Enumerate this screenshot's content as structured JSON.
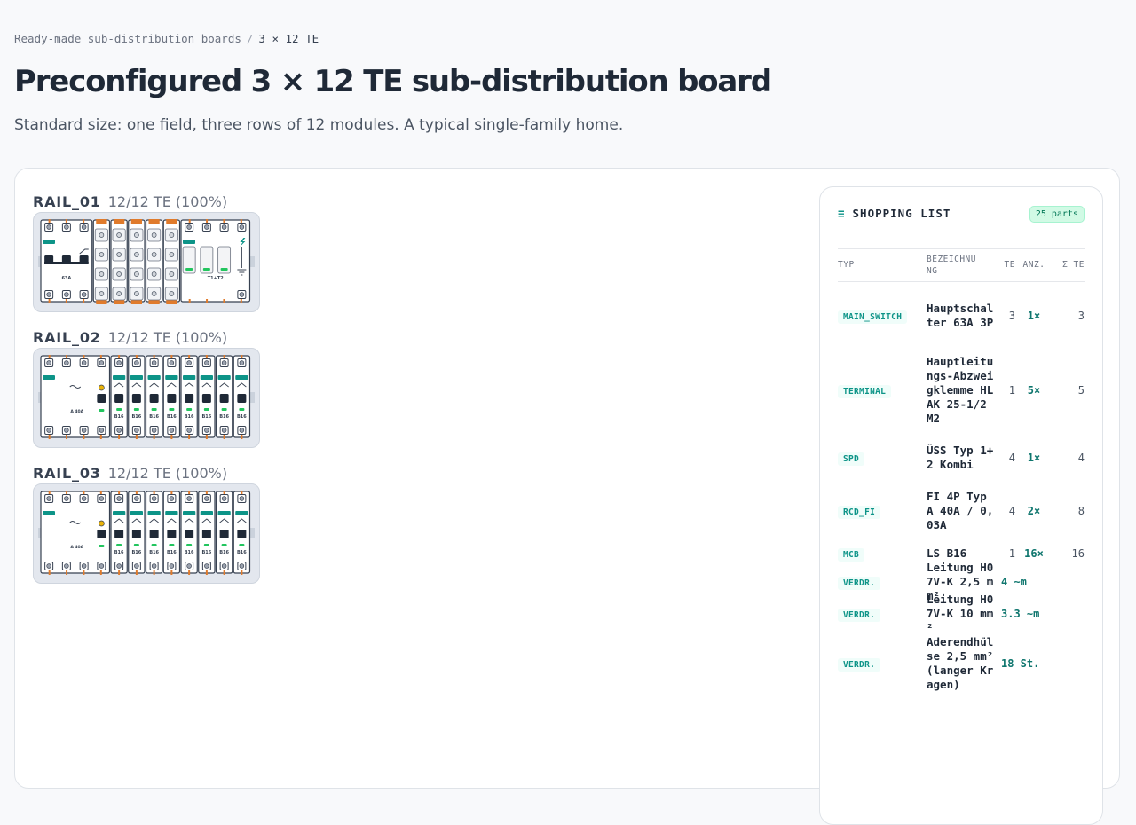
{
  "breadcrumb": {
    "parent": "Ready-made sub-distribution boards",
    "separator": "/",
    "current": "3 × 12 TE"
  },
  "page": {
    "title": "Preconfigured 3 × 12 TE sub-distribution board",
    "subtitle": "Standard size: one field, three rows of 12 modules. A typical single-family home."
  },
  "rails": [
    {
      "name": "RAIL_01",
      "usage": "12/12 TE (100%)",
      "modules": [
        {
          "kind": "main_switch",
          "width": 3,
          "label": "63A"
        },
        {
          "kind": "terminal",
          "width": 1
        },
        {
          "kind": "terminal",
          "width": 1
        },
        {
          "kind": "terminal",
          "width": 1
        },
        {
          "kind": "terminal",
          "width": 1
        },
        {
          "kind": "terminal",
          "width": 1
        },
        {
          "kind": "spd",
          "width": 4,
          "label": "T1+T2"
        }
      ]
    },
    {
      "name": "RAIL_02",
      "usage": "12/12 TE (100%)",
      "modules": [
        {
          "kind": "rcd",
          "width": 4,
          "label": "A 40A"
        },
        {
          "kind": "mcb",
          "width": 1,
          "label": "B16"
        },
        {
          "kind": "mcb",
          "width": 1,
          "label": "B16"
        },
        {
          "kind": "mcb",
          "width": 1,
          "label": "B16"
        },
        {
          "kind": "mcb",
          "width": 1,
          "label": "B16"
        },
        {
          "kind": "mcb",
          "width": 1,
          "label": "B16"
        },
        {
          "kind": "mcb",
          "width": 1,
          "label": "B16"
        },
        {
          "kind": "mcb",
          "width": 1,
          "label": "B16"
        },
        {
          "kind": "mcb",
          "width": 1,
          "label": "B16"
        }
      ]
    },
    {
      "name": "RAIL_03",
      "usage": "12/12 TE (100%)",
      "modules": [
        {
          "kind": "rcd",
          "width": 4,
          "label": "A 40A"
        },
        {
          "kind": "mcb",
          "width": 1,
          "label": "B16"
        },
        {
          "kind": "mcb",
          "width": 1,
          "label": "B16"
        },
        {
          "kind": "mcb",
          "width": 1,
          "label": "B16"
        },
        {
          "kind": "mcb",
          "width": 1,
          "label": "B16"
        },
        {
          "kind": "mcb",
          "width": 1,
          "label": "B16"
        },
        {
          "kind": "mcb",
          "width": 1,
          "label": "B16"
        },
        {
          "kind": "mcb",
          "width": 1,
          "label": "B16"
        },
        {
          "kind": "mcb",
          "width": 1,
          "label": "B16"
        }
      ]
    }
  ],
  "shopping": {
    "icon": "list-icon",
    "title": "SHOPPING LIST",
    "badge": "25 parts",
    "headers": {
      "typ": "TYP",
      "bez": "BEZEICHNUNG",
      "te": "TE",
      "anz": "ANZ.",
      "sum": "Σ TE"
    },
    "rows": [
      {
        "typ": "MAIN_SWITCH",
        "bez": "Hauptschalter 63A 3P",
        "te": "3",
        "anz": "1×",
        "sum": "3"
      },
      {
        "typ": "TERMINAL",
        "bez": "Hauptleitungs-Abzweigklemme HLAK 25-1/2 M2",
        "te": "1",
        "anz": "5×",
        "sum": "5"
      },
      {
        "typ": "SPD",
        "bez": "ÜSS Typ 1+2 Kombi",
        "te": "4",
        "anz": "1×",
        "sum": "4"
      },
      {
        "typ": "RCD_FI",
        "bez": "FI 4P Typ A 40A / 0,03A",
        "te": "4",
        "anz": "2×",
        "sum": "8"
      },
      {
        "typ": "MCB",
        "bez": "LS B16",
        "te": "1",
        "anz": "16×",
        "sum": "16"
      },
      {
        "typ": "VERDR.",
        "bez": "Leitung H07V-K 2,5 mm²",
        "qty": "4 ~m"
      },
      {
        "typ": "VERDR.",
        "bez": "Leitung H07V-K 10 mm²",
        "qty": "3.3 ~m"
      },
      {
        "typ": "VERDR.",
        "bez": "Aderendhülse 2,5 mm² (langer Kragen)",
        "qty": "18 St."
      }
    ]
  },
  "colors": {
    "accent": "#0d9488",
    "badge_bg": "#d1fae5",
    "rail_bg": "#e3e7ee",
    "handle": "#1f2937",
    "led_green": "#22c55e",
    "led_yellow": "#eab308",
    "terminal_orange": "#e07b2c"
  }
}
